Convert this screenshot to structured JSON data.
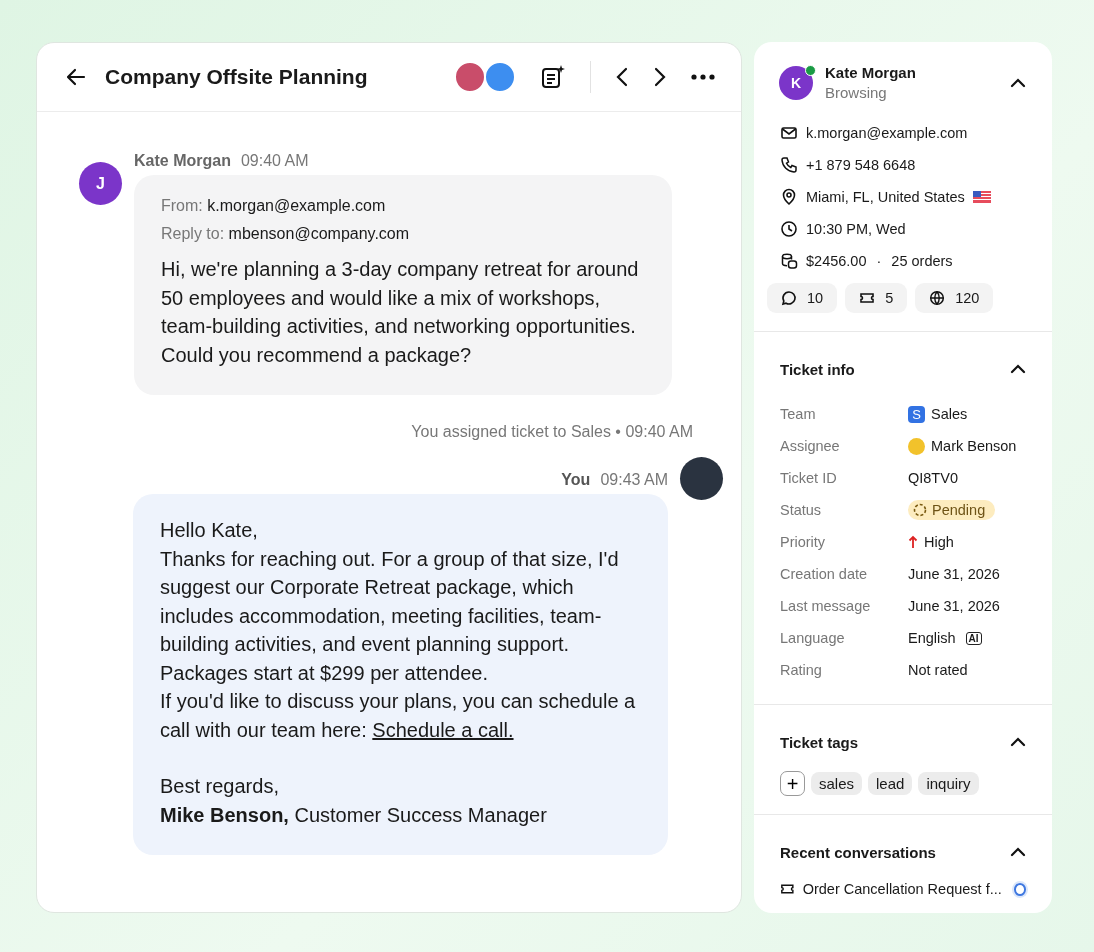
{
  "conversation": {
    "title": "Company Offsite Planning",
    "messages": [
      {
        "kind": "incoming",
        "author": "Kate Morgan",
        "time": "09:40 AM",
        "avatar": "J",
        "from_label": "From:",
        "from": "k.morgan@example.com",
        "reply_label": "Reply to:",
        "reply_to": "mbenson@company.com",
        "paragraphs": [
          "Hi, we're planning a 3-day company retreat for around 50 employees and would like a mix of workshops, team-building activities, and networking opportunities.",
          "Could you recommend a package?"
        ]
      },
      {
        "kind": "event",
        "text": "You assigned ticket to Sales • 09:40 AM"
      },
      {
        "kind": "outgoing",
        "author": "You",
        "time": "09:43 AM",
        "paragraphs": [
          "Hello Kate,",
          "Thanks for reaching out. For a group of that size, I'd suggest our Corporate Retreat package, which includes accommodation, meeting facilities, team-building activities, and event planning support.",
          "Packages start at $299 per attendee."
        ],
        "link_intro": "If you'd like to discuss your plans, you can schedule a call with our team here:",
        "link": "Schedule a call.",
        "closing": "Best regards,",
        "signature": "**Mike Benson,** Customer Success Manager"
      }
    ]
  },
  "contact": {
    "name": "Kate Morgan",
    "initial": "K",
    "online": true,
    "activity": "Browsing",
    "expanded": true,
    "details": [
      {
        "kind": "email",
        "text": "k.morgan@example.com"
      },
      {
        "kind": "phone",
        "text": "+1 879 548 6648"
      },
      {
        "kind": "location",
        "text": "Miami, FL, United States"
      },
      {
        "kind": "time",
        "text": "10:30 PM, Wed"
      },
      {
        "kind": "money",
        "text": "$2456.00",
        "separator": "·",
        "extra": "25 orders"
      }
    ],
    "stats": [
      {
        "kind": "chats",
        "text": "10"
      },
      {
        "kind": "tickets",
        "text": "5"
      },
      {
        "kind": "visits",
        "text": "120"
      }
    ]
  },
  "ticket_info": {
    "title": "Ticket info",
    "expanded": true,
    "fields": [
      {
        "label": "Team",
        "kind": "team",
        "badge": "S",
        "value": "Sales"
      },
      {
        "label": "Assignee",
        "kind": "person",
        "value": "Mark Benson"
      },
      {
        "label": "Ticket ID",
        "kind": "text",
        "value": "QI8TV0"
      },
      {
        "label": "Status",
        "kind": "status",
        "value": "Pending"
      },
      {
        "label": "Priority",
        "kind": "priority",
        "value": "High"
      },
      {
        "label": "Creation date",
        "kind": "text",
        "value": "June 31, 2026"
      },
      {
        "label": "Last message",
        "kind": "text",
        "value": "June 31, 2026"
      },
      {
        "label": "Language",
        "kind": "language",
        "value": "English",
        "badge": "AI"
      },
      {
        "label": "Rating",
        "kind": "text",
        "value": "Not rated"
      }
    ]
  },
  "ticket_tags": {
    "title": "Ticket tags",
    "expanded": true,
    "add": "+",
    "tags": [
      "sales",
      "lead",
      "inquiry"
    ]
  },
  "recent_conversations": {
    "title": "Recent conversations",
    "expanded": true,
    "items": [
      {
        "title": "Order Cancellation Request f...",
        "unread": true
      }
    ]
  }
}
